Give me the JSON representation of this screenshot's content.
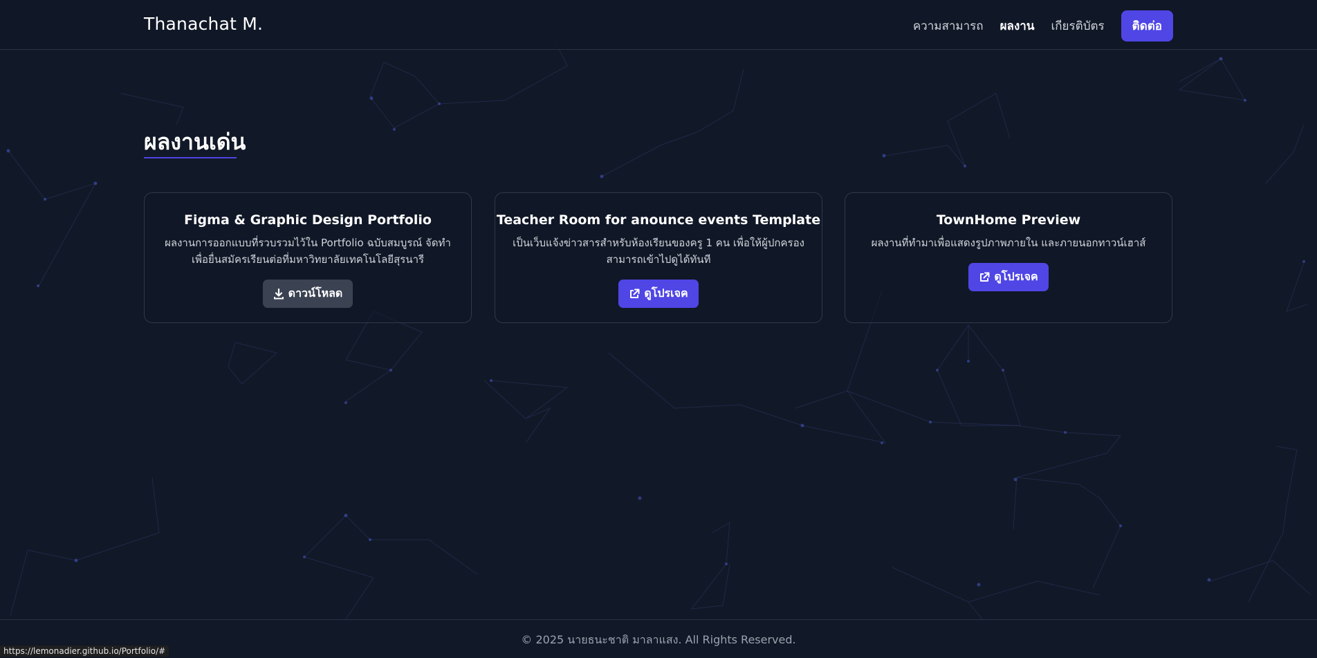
{
  "navbar": {
    "brand": "Thanachat M.",
    "links": [
      {
        "label": "ความสามารถ",
        "active": false
      },
      {
        "label": "ผลงาน",
        "active": true
      },
      {
        "label": "เกียรติบัตร",
        "active": false
      }
    ],
    "contact_label": "ติดต่อ"
  },
  "section": {
    "title": "ผลงานเด่น"
  },
  "projects": [
    {
      "title": "Figma & Graphic Design Portfolio",
      "description": "ผลงานการออกแบบที่รวบรวมไว้ใน Portfolio ฉบับสมบูรณ์ จัดทำเพื่อยื่นสมัครเรียนต่อที่มหาวิทยาลัยเทคโนโลยีสุรนารี",
      "button_label": "ดาวน์โหลด",
      "button_icon": "download-icon"
    },
    {
      "title": "Teacher Room for anounce events Template",
      "description": "เป็นเว็บแจ้งข่าวสารสำหรับห้องเรียนของครู 1 คน เพื่อให้ผู้ปกครองสามารถเข้าไปดูได้ทันที",
      "button_label": "ดูโปรเจค",
      "button_icon": "external-link-icon"
    },
    {
      "title": "TownHome Preview",
      "description": "ผลงานที่ทำมาเพื่อแสดงรูปภาพภายใน และภายนอกทาวน์เฮาส์",
      "button_label": "ดูโปรเจค",
      "button_icon": "external-link-icon"
    }
  ],
  "footer": {
    "text": "© 2025 นายธนะชาติ มาลาแสง. All Rights Reserved."
  },
  "status_bar": {
    "url": "https://lemonadier.github.io/Portfolio/#"
  },
  "colors": {
    "background": "#111827",
    "accent": "#4f46e5",
    "secondary_button": "#3b4252",
    "card_border": "#2f3a4d"
  }
}
